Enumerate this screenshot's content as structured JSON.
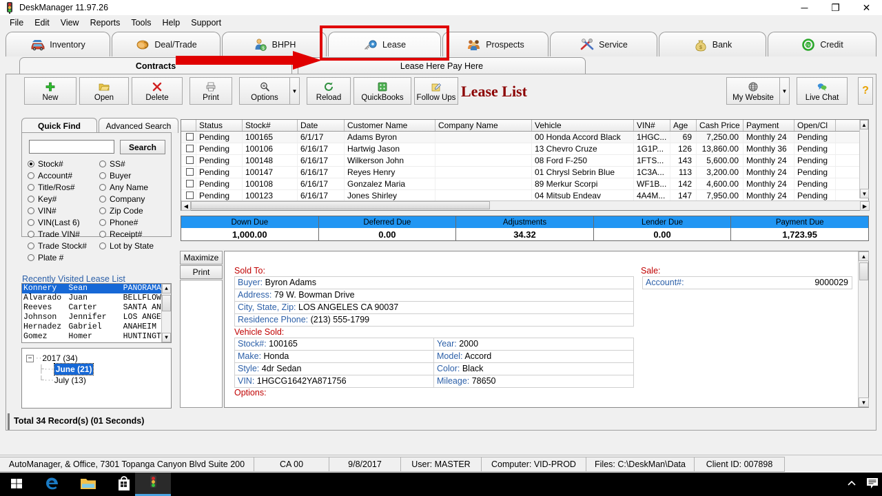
{
  "window": {
    "title": "DeskManager 11.97.26",
    "icon": "traffic-light-icon",
    "minimize": "─",
    "maximize": "❐",
    "close": "✕"
  },
  "menubar": {
    "items": [
      "File",
      "Edit",
      "View",
      "Reports",
      "Tools",
      "Help",
      "Support"
    ]
  },
  "main_tabs": [
    {
      "label": "Inventory",
      "icon": "car-icon",
      "active": false
    },
    {
      "label": "Deal/Trade",
      "icon": "handshake-icon",
      "active": false
    },
    {
      "label": "BHPH",
      "icon": "person-cash-icon",
      "active": false
    },
    {
      "label": "Lease",
      "icon": "key-icon",
      "active": true
    },
    {
      "label": "Prospects",
      "icon": "people-icon",
      "active": false
    },
    {
      "label": "Service",
      "icon": "tools-icon",
      "active": false
    },
    {
      "label": "Bank",
      "icon": "money-bag-icon",
      "active": false
    },
    {
      "label": "Credit",
      "icon": "credit-meter-icon",
      "active": false
    }
  ],
  "sub_tabs": [
    {
      "label": "Contracts",
      "active": true
    },
    {
      "label": "Lease Here Pay Here",
      "active": false
    }
  ],
  "toolbar": {
    "page_title": "Lease List",
    "buttons": [
      {
        "label": "New",
        "icon": "plus-icon"
      },
      {
        "label": "Open",
        "icon": "folder-open-icon"
      },
      {
        "label": "Delete",
        "icon": "x-icon"
      },
      {
        "label": "Print",
        "icon": "printer-icon"
      },
      {
        "label": "Options",
        "icon": "magnifier-gear-icon"
      },
      {
        "label": "Reload",
        "icon": "refresh-icon"
      },
      {
        "label": "QuickBooks",
        "icon": "quickbooks-icon"
      },
      {
        "label": "Follow Ups",
        "icon": "note-pencil-icon"
      }
    ],
    "options_dropdown": "▼",
    "my_website": {
      "label": "My Website",
      "icon": "globe-icon",
      "dropdown": "▼"
    },
    "live_chat": {
      "label": "Live Chat",
      "icon": "chat-bubbles-icon"
    },
    "help": "?"
  },
  "quick_find": {
    "tabs": [
      {
        "label": "Quick Find",
        "active": true
      },
      {
        "label": "Advanced Search",
        "active": false
      }
    ],
    "search_value": "",
    "search_button": "Search",
    "radio_rows": [
      {
        "left": "Stock#",
        "right": "SS#"
      },
      {
        "left": "Account#",
        "right": "Buyer"
      },
      {
        "left": "Title/Ros#",
        "right": "Any Name"
      },
      {
        "left": "Key#",
        "right": "Company"
      },
      {
        "left": "VIN#",
        "right": "Zip Code"
      },
      {
        "left": "VIN(Last 6)",
        "right": "Phone#"
      },
      {
        "left": "Trade VIN#",
        "right": "Receipt#"
      },
      {
        "left": "Trade Stock#",
        "right": "Lot by State"
      },
      {
        "left": "Plate #",
        "right": ""
      }
    ],
    "selected": "Stock#"
  },
  "recent": {
    "label": "Recently Visited Lease List",
    "rows": [
      {
        "last": "Konnery",
        "first": "Sean",
        "city": "PANORAMA",
        "selected": true
      },
      {
        "last": "Alvarado",
        "first": "Juan",
        "city": "BELLFLOW",
        "selected": false
      },
      {
        "last": "Reeves",
        "first": "Carter",
        "city": "SANTA AN",
        "selected": false
      },
      {
        "last": "Johnson",
        "first": "Jennifer",
        "city": "LOS ANGE",
        "selected": false
      },
      {
        "last": "Hernadez",
        "first": "Gabriel",
        "city": "ANAHEIM",
        "selected": false
      },
      {
        "last": "Gomez",
        "first": "Homer",
        "city": "HUNTINGT",
        "selected": false
      }
    ]
  },
  "tree": {
    "root": "2017 (34)",
    "expander": "−",
    "children": [
      {
        "label": "June (21)",
        "selected": true
      },
      {
        "label": "July (13)",
        "selected": false
      }
    ]
  },
  "grid": {
    "columns": [
      "",
      "Status",
      "Stock#",
      "Date",
      "Customer Name",
      "Company Name",
      "Vehicle",
      "VIN#",
      "Age",
      "Cash Price",
      "Payment",
      "Open/Cl"
    ],
    "rows": [
      {
        "status": "Pending",
        "stock": "100165",
        "date": "6/1/17",
        "customer": "Adams Byron",
        "company": "",
        "vehicle": "00 Honda Accord Black",
        "vin": "1HGC...",
        "age": "69",
        "cash": "7,250.00",
        "payment": "Monthly 24",
        "open": "Pending"
      },
      {
        "status": "Pending",
        "stock": "100106",
        "date": "6/16/17",
        "customer": "Hartwig Jason",
        "company": "",
        "vehicle": "13 Chevro Cruze",
        "vin": "1G1P...",
        "age": "126",
        "cash": "13,860.00",
        "payment": "Monthly 36",
        "open": "Pending"
      },
      {
        "status": "Pending",
        "stock": "100148",
        "date": "6/16/17",
        "customer": "Wilkerson John",
        "company": "",
        "vehicle": "08 Ford F-250",
        "vin": "1FTS...",
        "age": "143",
        "cash": "5,600.00",
        "payment": "Monthly 24",
        "open": "Pending"
      },
      {
        "status": "Pending",
        "stock": "100147",
        "date": "6/16/17",
        "customer": "Reyes Henry",
        "company": "",
        "vehicle": "01 Chrysl Sebrin Blue",
        "vin": "1C3A...",
        "age": "113",
        "cash": "3,200.00",
        "payment": "Monthly 24",
        "open": "Pending"
      },
      {
        "status": "Pending",
        "stock": "100108",
        "date": "6/16/17",
        "customer": "Gonzalez Maria",
        "company": "",
        "vehicle": "89 Merkur Scorpi",
        "vin": "WF1B...",
        "age": "142",
        "cash": "4,600.00",
        "payment": "Monthly 24",
        "open": "Pending"
      },
      {
        "status": "Pending",
        "stock": "100123",
        "date": "6/16/17",
        "customer": "Jones Shirley",
        "company": "",
        "vehicle": "04 Mitsub Endeav",
        "vin": "4A4M...",
        "age": "147",
        "cash": "7,950.00",
        "payment": "Monthly 24",
        "open": "Pending"
      }
    ]
  },
  "totals": [
    {
      "caption": "Down Due",
      "value": "1,000.00"
    },
    {
      "caption": "Deferred Due",
      "value": "0.00"
    },
    {
      "caption": "Adjustments",
      "value": "34.32"
    },
    {
      "caption": "Lender Due",
      "value": "0.00"
    },
    {
      "caption": "Payment Due",
      "value": "1,723.95"
    }
  ],
  "detail": {
    "side_buttons": [
      "Maximize",
      "Print"
    ],
    "sold_to_header": "Sold To:",
    "sold_to": [
      {
        "label": "Buyer:",
        "value": "Byron Adams"
      },
      {
        "label": "Address:",
        "value": "79 W. Bowman Drive"
      },
      {
        "label": "City, State, Zip:",
        "value": "LOS ANGELES CA 90037"
      },
      {
        "label": "Residence Phone:",
        "value": "(213) 555-1799"
      }
    ],
    "sale_header": "Sale:",
    "sale": [
      {
        "label": "Account#:",
        "value": "9000029"
      }
    ],
    "vehicle_header": "Vehicle Sold:",
    "vehicle_left": [
      {
        "label": "Stock#:",
        "value": "100165"
      },
      {
        "label": "Make:",
        "value": "Honda"
      },
      {
        "label": "Style:",
        "value": "4dr Sedan"
      },
      {
        "label": "VIN:",
        "value": "1HGCG1642YA871756"
      }
    ],
    "vehicle_right": [
      {
        "label": "Year:",
        "value": "2000"
      },
      {
        "label": "Model:",
        "value": "Accord"
      },
      {
        "label": "Color:",
        "value": "Black"
      },
      {
        "label": "Mileage:",
        "value": "78650"
      }
    ],
    "options_header": "Options:"
  },
  "record_count": "Total 34 Record(s) (01 Seconds)",
  "statusbar": [
    "AutoManager, & Office, 7301 Topanga Canyon Blvd Suite 200",
    "CA 00",
    "9/8/2017",
    "User: MASTER",
    "Computer: VID-PROD",
    "Files: C:\\DeskMan\\Data",
    "Client ID: 007898"
  ],
  "taskbar": {
    "items": [
      {
        "icon": "windows-start-icon",
        "active": false
      },
      {
        "icon": "edge-icon",
        "active": false
      },
      {
        "icon": "file-explorer-icon",
        "active": false
      },
      {
        "icon": "store-icon",
        "active": false
      },
      {
        "icon": "deskmanager-icon",
        "active": true
      }
    ],
    "tray": [
      "chevron-up-icon",
      "action-center-icon"
    ]
  },
  "annotation": {
    "highlight_target": "Lease",
    "color": "#e00000"
  }
}
